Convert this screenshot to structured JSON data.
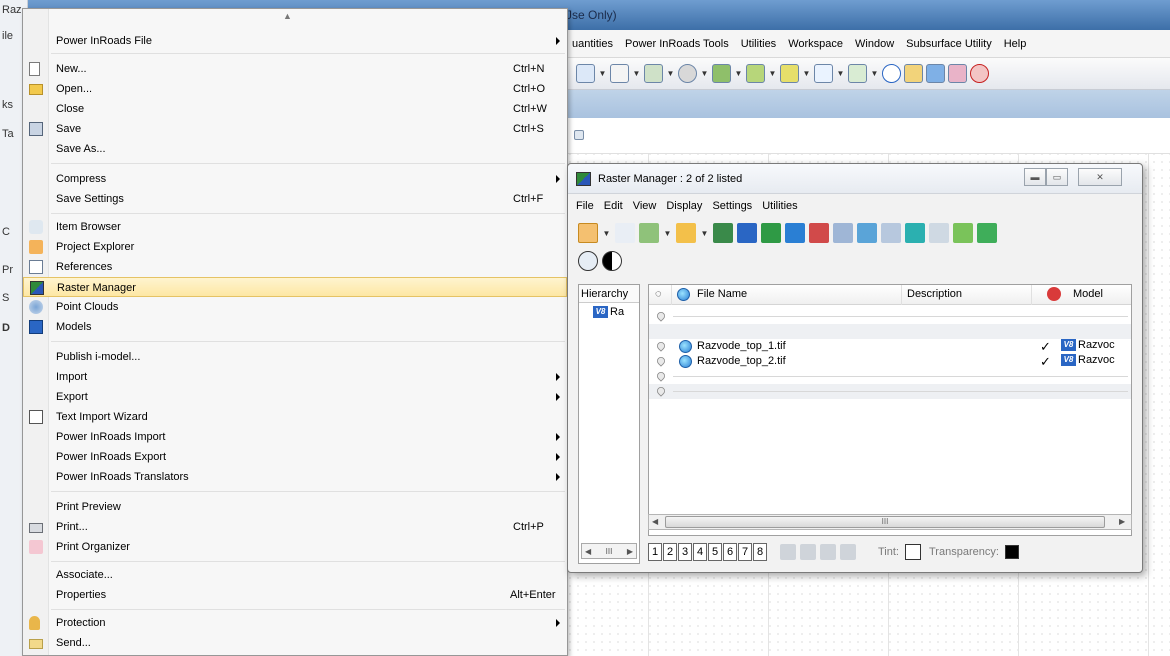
{
  "window": {
    "title_fragment": "Jse Only)"
  },
  "app_menubar": [
    "uantities",
    "Power InRoads Tools",
    "Utilities",
    "Workspace",
    "Window",
    "Subsurface Utility",
    "Help"
  ],
  "left_strip": [
    "Raz",
    "ile",
    "ks",
    "Ta",
    "C",
    "Pr",
    "S",
    "D"
  ],
  "file_menu": {
    "header": "Power InRoads File",
    "items": [
      {
        "label": "New...",
        "shortcut": "Ctrl+N",
        "icon": "new-file-icon"
      },
      {
        "label": "Open...",
        "shortcut": "Ctrl+O",
        "icon": "open-folder-icon"
      },
      {
        "label": "Close",
        "shortcut": "Ctrl+W",
        "icon": ""
      },
      {
        "label": "Save",
        "shortcut": "Ctrl+S",
        "icon": "save-disk-icon"
      },
      {
        "label": "Save As...",
        "shortcut": "",
        "icon": ""
      },
      {
        "label": "Compress",
        "shortcut": "",
        "icon": ""
      },
      {
        "label": "Save Settings",
        "shortcut": "Ctrl+F",
        "icon": ""
      },
      {
        "label": "Item Browser",
        "shortcut": "",
        "icon": "item-browser-icon"
      },
      {
        "label": "Project Explorer",
        "shortcut": "",
        "icon": "project-explorer-icon"
      },
      {
        "label": "References",
        "shortcut": "",
        "icon": "references-icon"
      },
      {
        "label": "Raster Manager",
        "shortcut": "",
        "icon": "raster-manager-icon"
      },
      {
        "label": "Point Clouds",
        "shortcut": "",
        "icon": "point-clouds-icon"
      },
      {
        "label": "Models",
        "shortcut": "",
        "icon": "models-icon"
      },
      {
        "label": "Publish i-model...",
        "shortcut": "",
        "icon": ""
      },
      {
        "label": "Import",
        "shortcut": "",
        "icon": ""
      },
      {
        "label": "Export",
        "shortcut": "",
        "icon": ""
      },
      {
        "label": "Text Import Wizard",
        "shortcut": "",
        "icon": "text-import-icon"
      },
      {
        "label": "Power InRoads Import",
        "shortcut": "",
        "icon": ""
      },
      {
        "label": "Power InRoads Export",
        "shortcut": "",
        "icon": ""
      },
      {
        "label": "Power InRoads Translators",
        "shortcut": "",
        "icon": ""
      },
      {
        "label": "Print Preview",
        "shortcut": "",
        "icon": ""
      },
      {
        "label": "Print...",
        "shortcut": "Ctrl+P",
        "icon": "print-icon"
      },
      {
        "label": "Print Organizer",
        "shortcut": "",
        "icon": "print-organizer-icon"
      },
      {
        "label": "Associate...",
        "shortcut": "",
        "icon": ""
      },
      {
        "label": "Properties",
        "shortcut": "Alt+Enter",
        "icon": ""
      },
      {
        "label": "Protection",
        "shortcut": "",
        "icon": "protection-icon"
      },
      {
        "label": "Send...",
        "shortcut": "",
        "icon": "send-icon"
      }
    ]
  },
  "raster_manager": {
    "title": "Raster Manager : 2 of 2 listed",
    "menu": [
      "File",
      "Edit",
      "View",
      "Display",
      "Settings",
      "Utilities"
    ],
    "hierarchy_header": "Hierarchy",
    "hierarchy_item": "Ra",
    "v8_label": "V8",
    "columns": {
      "file_name": "File Name",
      "description": "Description",
      "model": "Model"
    },
    "rows": [
      {
        "file": "Razvode_top_1.tif",
        "check": "✓",
        "model": "Razvoc"
      },
      {
        "file": "Razvode_top_2.tif",
        "check": "✓",
        "model": "Razvoc"
      }
    ],
    "scroll_thumb": "III",
    "hier_scroll_thumb": "III",
    "pages": [
      "1",
      "2",
      "3",
      "4",
      "5",
      "6",
      "7",
      "8"
    ],
    "tint_label": "Tint:",
    "transparency_label": "Transparency:"
  }
}
